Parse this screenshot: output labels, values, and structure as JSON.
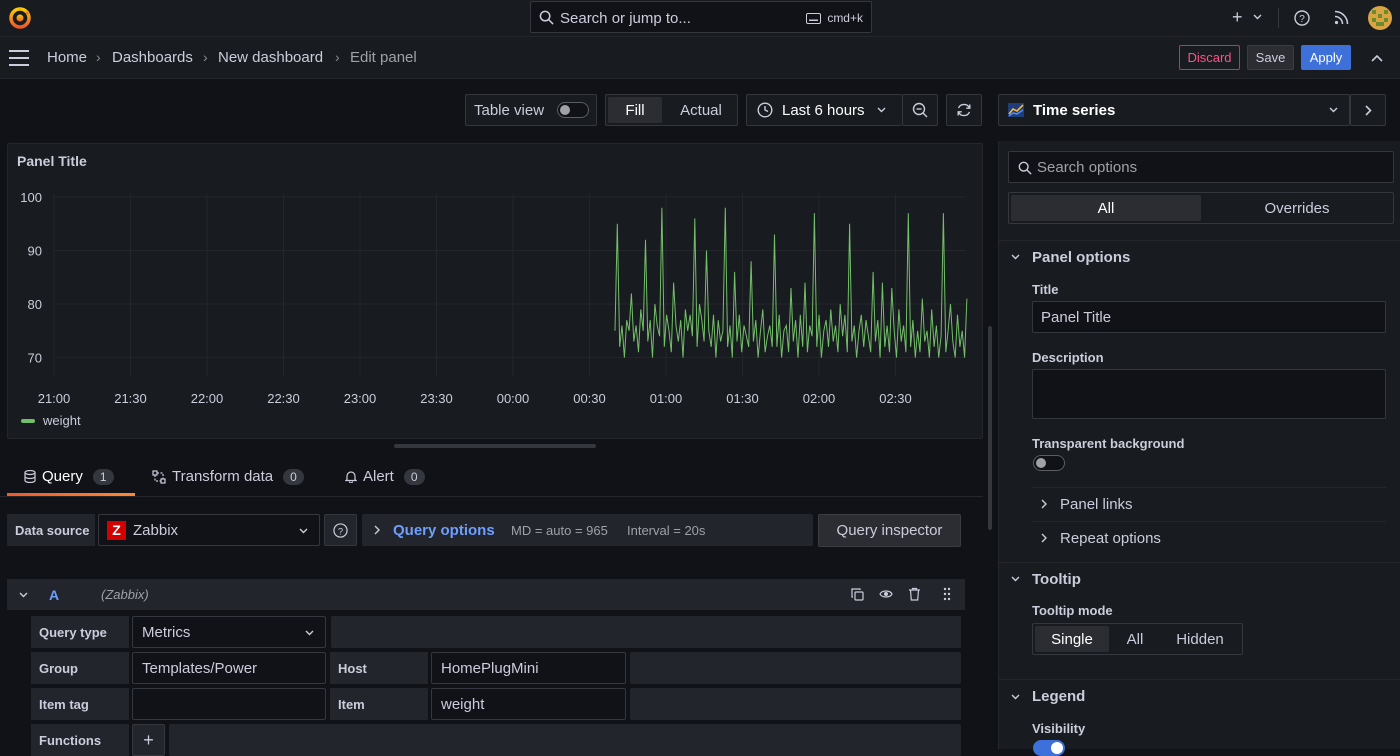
{
  "topbar": {
    "search_placeholder": "Search or jump to...",
    "search_shortcut": "cmd+k",
    "icons": [
      "grafana-logo-icon",
      "search-icon",
      "keyboard-icon",
      "plus-icon",
      "help-icon",
      "rss-icon",
      "avatar"
    ]
  },
  "breadcrumbs": [
    "Home",
    "Dashboards",
    "New dashboard",
    "Edit panel"
  ],
  "actions": {
    "discard": "Discard",
    "save": "Save",
    "apply": "Apply"
  },
  "toolbar": {
    "table_view": "Table view",
    "fill": "Fill",
    "actual": "Actual",
    "time_range": "Last 6 hours",
    "visualization": "Time series"
  },
  "panel": {
    "title": "Panel Title",
    "legend": "weight",
    "series_color": "#73bf69"
  },
  "chart_data": {
    "type": "line",
    "title": "Panel Title",
    "x_ticks": [
      "21:00",
      "21:30",
      "22:00",
      "22:30",
      "23:00",
      "23:30",
      "00:00",
      "00:30",
      "01:00",
      "01:30",
      "02:00",
      "02:30"
    ],
    "y_ticks": [
      "100",
      "90",
      "80",
      "70"
    ],
    "ylim": [
      66,
      100
    ],
    "series": [
      {
        "name": "weight",
        "color": "#73bf69",
        "start_time": "00:40",
        "end_time": "02:58",
        "values": [
          75,
          95,
          72,
          76,
          70,
          77,
          75,
          82,
          73,
          76,
          71,
          79,
          75,
          92,
          73,
          77,
          70,
          80,
          76,
          74,
          98,
          72,
          78,
          75,
          71,
          84,
          76,
          73,
          77,
          70,
          79,
          75,
          78,
          74,
          96,
          72,
          80,
          77,
          73,
          90,
          75,
          72,
          78,
          70,
          77,
          73,
          75,
          98,
          72,
          76,
          70,
          86,
          73,
          78,
          71,
          76,
          74,
          72,
          88,
          73,
          77,
          70,
          75,
          79,
          71,
          74,
          76,
          72,
          93,
          72,
          78,
          70,
          75,
          76,
          71,
          83,
          73,
          77,
          70,
          78,
          72,
          84,
          71,
          76,
          74,
          97,
          72,
          78,
          70,
          75,
          77,
          72,
          79,
          73,
          76,
          71,
          80,
          74,
          78,
          71,
          95,
          73,
          76,
          70,
          75,
          78,
          72,
          77,
          74,
          71,
          86,
          73,
          77,
          70,
          84,
          72,
          76,
          71,
          83,
          75,
          70,
          79,
          73,
          76,
          71,
          97,
          72,
          77,
          70,
          75,
          71,
          81,
          73,
          75,
          70,
          79,
          72,
          76,
          70,
          74,
          97,
          71,
          75,
          80,
          73,
          70,
          78,
          72,
          75,
          70,
          81
        ]
      }
    ]
  },
  "query_tabs": [
    {
      "label": "Query",
      "count": "1"
    },
    {
      "label": "Transform data",
      "count": "0"
    },
    {
      "label": "Alert",
      "count": "0"
    }
  ],
  "datasource": {
    "label": "Data source",
    "value": "Zabbix",
    "query_options": "Query options",
    "md": "MD = auto = 965",
    "interval": "Interval = 20s",
    "inspector": "Query inspector"
  },
  "query": {
    "ref": "A",
    "datasource_tag": "(Zabbix)",
    "query_type_label": "Query type",
    "query_type_value": "Metrics",
    "group_label": "Group",
    "group_value": "Templates/Power",
    "host_label": "Host",
    "host_value": "HomePlugMini",
    "item_tag_label": "Item tag",
    "item_tag_value": "",
    "item_label": "Item",
    "item_value": "weight",
    "functions_label": "Functions"
  },
  "options": {
    "search_placeholder": "Search options",
    "tab_all": "All",
    "tab_overrides": "Overrides",
    "panel_options": "Panel options",
    "title_label": "Title",
    "title_value": "Panel Title",
    "description_label": "Description",
    "transparent_label": "Transparent background",
    "panel_links": "Panel links",
    "repeat_options": "Repeat options",
    "tooltip": "Tooltip",
    "tooltip_mode_label": "Tooltip mode",
    "tooltip_modes": [
      "Single",
      "All",
      "Hidden"
    ],
    "legend": "Legend",
    "visibility_label": "Visibility"
  }
}
